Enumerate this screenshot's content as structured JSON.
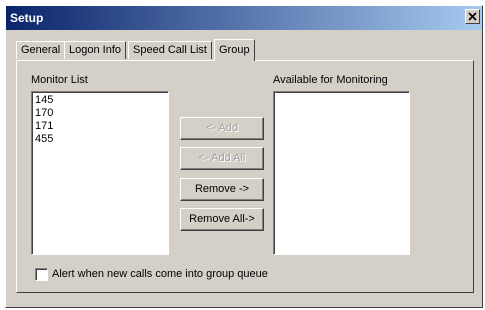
{
  "window": {
    "title": "Setup",
    "close_icon": "close-icon"
  },
  "tabs": [
    {
      "label": "General",
      "active": false
    },
    {
      "label": "Logon Info",
      "active": false
    },
    {
      "label": "Speed Call List",
      "active": false
    },
    {
      "label": "Group",
      "active": true
    }
  ],
  "group": {
    "monitor_list_label": "Monitor List",
    "monitor_list_items": [
      "145",
      "170",
      "171",
      "455"
    ],
    "available_label": "Available for Monitoring",
    "available_items": [],
    "buttons": {
      "add": {
        "label": "<- Add",
        "enabled": false
      },
      "add_all": {
        "label": "<- Add All",
        "enabled": false
      },
      "remove": {
        "label": "Remove ->",
        "enabled": true
      },
      "remove_all": {
        "label": "Remove All->",
        "enabled": true
      }
    },
    "alert_checkbox": {
      "label": "Alert when new calls come into group queue",
      "checked": false
    }
  },
  "colors": {
    "title_gradient_start": "#0a246a",
    "title_gradient_end": "#a6caf0",
    "face": "#d4d0c8"
  }
}
